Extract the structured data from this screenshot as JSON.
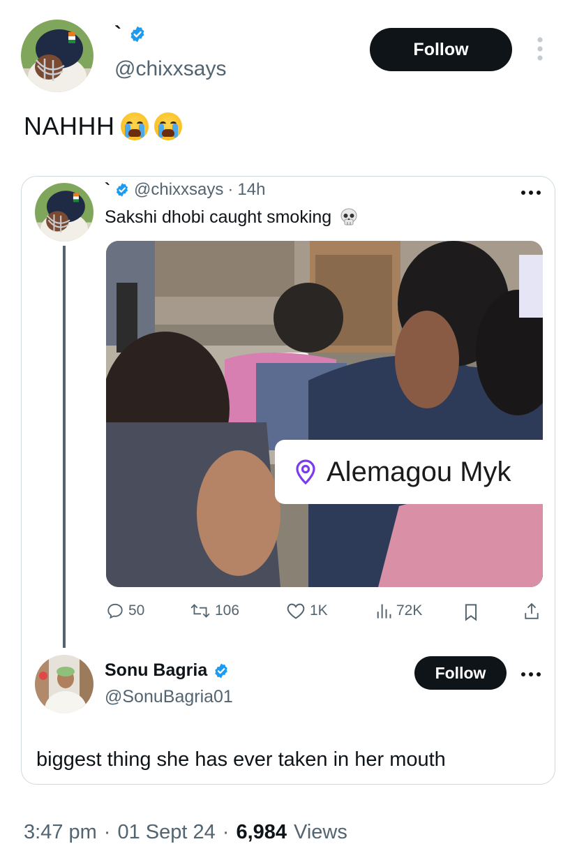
{
  "tweet": {
    "author": {
      "display_name": "`",
      "handle": "@chixxsays",
      "verified": true
    },
    "follow_label": "Follow",
    "text": "NAHHH",
    "emoji": [
      "loudly-crying-face-emoji",
      "loudly-crying-face-emoji"
    ],
    "footer": {
      "time": "3:47 pm",
      "sep1": "·",
      "date": "01 Sept 24",
      "sep2": "·",
      "views_count": "6,984",
      "views_label": "Views"
    }
  },
  "quoted": {
    "author": {
      "display_name": "`",
      "handle": "@chixxsays",
      "dot": "·",
      "time": "14h"
    },
    "text": "Sakshi dhobi caught smoking",
    "emoji": "skull-emoji",
    "location_tag": "Alemagou Myk",
    "stats": {
      "replies": "50",
      "reposts": "106",
      "likes": "1K",
      "views": "72K"
    }
  },
  "reply": {
    "author": {
      "display_name": "Sonu Bagria",
      "handle": "@SonuBagria01",
      "verified": true
    },
    "follow_label": "Follow",
    "text": "biggest thing she has ever taken in her mouth"
  },
  "colors": {
    "verified_blue": "#1d9bf0",
    "text": "#0f1419",
    "muted": "#536471",
    "border": "#cfd9de",
    "location_pin": "#7c3aed"
  }
}
